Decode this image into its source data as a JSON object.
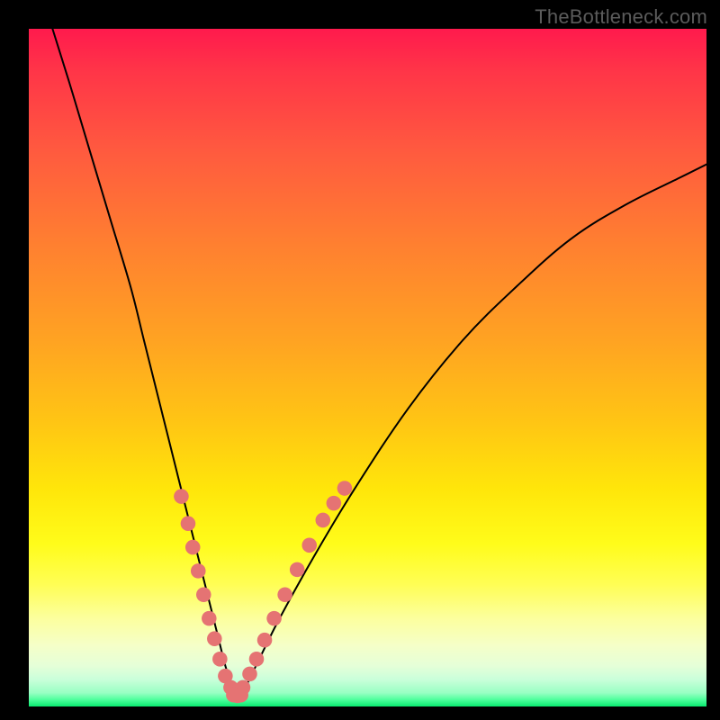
{
  "watermark": "TheBottleneck.com",
  "chart_data": {
    "type": "line",
    "title": "",
    "xlabel": "",
    "ylabel": "",
    "xlim": [
      0,
      100
    ],
    "ylim": [
      0,
      100
    ],
    "grid": false,
    "legend": false,
    "gradient_stops": [
      {
        "pct": 0,
        "color": "#ff1a4d"
      },
      {
        "pct": 18,
        "color": "#ff5a3f"
      },
      {
        "pct": 46,
        "color": "#ffa322"
      },
      {
        "pct": 76,
        "color": "#fffc1a"
      },
      {
        "pct": 94,
        "color": "#e5ffd8"
      },
      {
        "pct": 100,
        "color": "#08e86f"
      }
    ],
    "series": [
      {
        "name": "left-branch",
        "note": "Steep descending curve from top-left into the valley minimum",
        "x": [
          3.5,
          6,
          9,
          12,
          15,
          17,
          19,
          20.5,
          22,
          23.5,
          25,
          26.5,
          28,
          29,
          30,
          30.6
        ],
        "y": [
          100,
          92,
          82,
          72,
          62,
          54,
          46,
          40,
          34,
          28,
          22,
          16,
          10,
          6,
          3,
          1.5
        ]
      },
      {
        "name": "right-branch",
        "note": "Rising curve from valley minimum toward upper-right",
        "x": [
          30.6,
          32,
          34,
          37,
          42,
          48,
          56,
          64,
          72,
          80,
          88,
          96,
          100
        ],
        "y": [
          1.5,
          3,
          7,
          13,
          22,
          32,
          44,
          54,
          62,
          69,
          74,
          78,
          80
        ]
      },
      {
        "name": "valley-floor",
        "note": "Short flat segment at minimum y",
        "x": [
          29.5,
          31.8
        ],
        "y": [
          1.5,
          1.5
        ]
      }
    ],
    "markers": [
      {
        "note": "Dots along lower portion of left branch",
        "points": [
          {
            "x": 22.5,
            "y": 31
          },
          {
            "x": 23.5,
            "y": 27
          },
          {
            "x": 24.2,
            "y": 23.5
          },
          {
            "x": 25.0,
            "y": 20
          },
          {
            "x": 25.8,
            "y": 16.5
          },
          {
            "x": 26.6,
            "y": 13
          },
          {
            "x": 27.4,
            "y": 10
          },
          {
            "x": 28.2,
            "y": 7
          },
          {
            "x": 29.0,
            "y": 4.5
          },
          {
            "x": 29.8,
            "y": 2.8
          }
        ]
      },
      {
        "note": "Dots along lower portion of right branch",
        "points": [
          {
            "x": 31.6,
            "y": 2.8
          },
          {
            "x": 32.6,
            "y": 4.8
          },
          {
            "x": 33.6,
            "y": 7
          },
          {
            "x": 34.8,
            "y": 9.8
          },
          {
            "x": 36.2,
            "y": 13
          },
          {
            "x": 37.8,
            "y": 16.5
          },
          {
            "x": 39.6,
            "y": 20.2
          },
          {
            "x": 41.4,
            "y": 23.8
          },
          {
            "x": 43.4,
            "y": 27.5
          },
          {
            "x": 45.0,
            "y": 30
          },
          {
            "x": 46.6,
            "y": 32.2
          }
        ]
      },
      {
        "note": "Dots across the valley floor",
        "points": [
          {
            "x": 30.2,
            "y": 1.7
          },
          {
            "x": 30.8,
            "y": 1.6
          },
          {
            "x": 31.3,
            "y": 1.7
          }
        ]
      }
    ],
    "marker_style": {
      "color": "#e57373",
      "radius_pct": 1.1
    }
  }
}
